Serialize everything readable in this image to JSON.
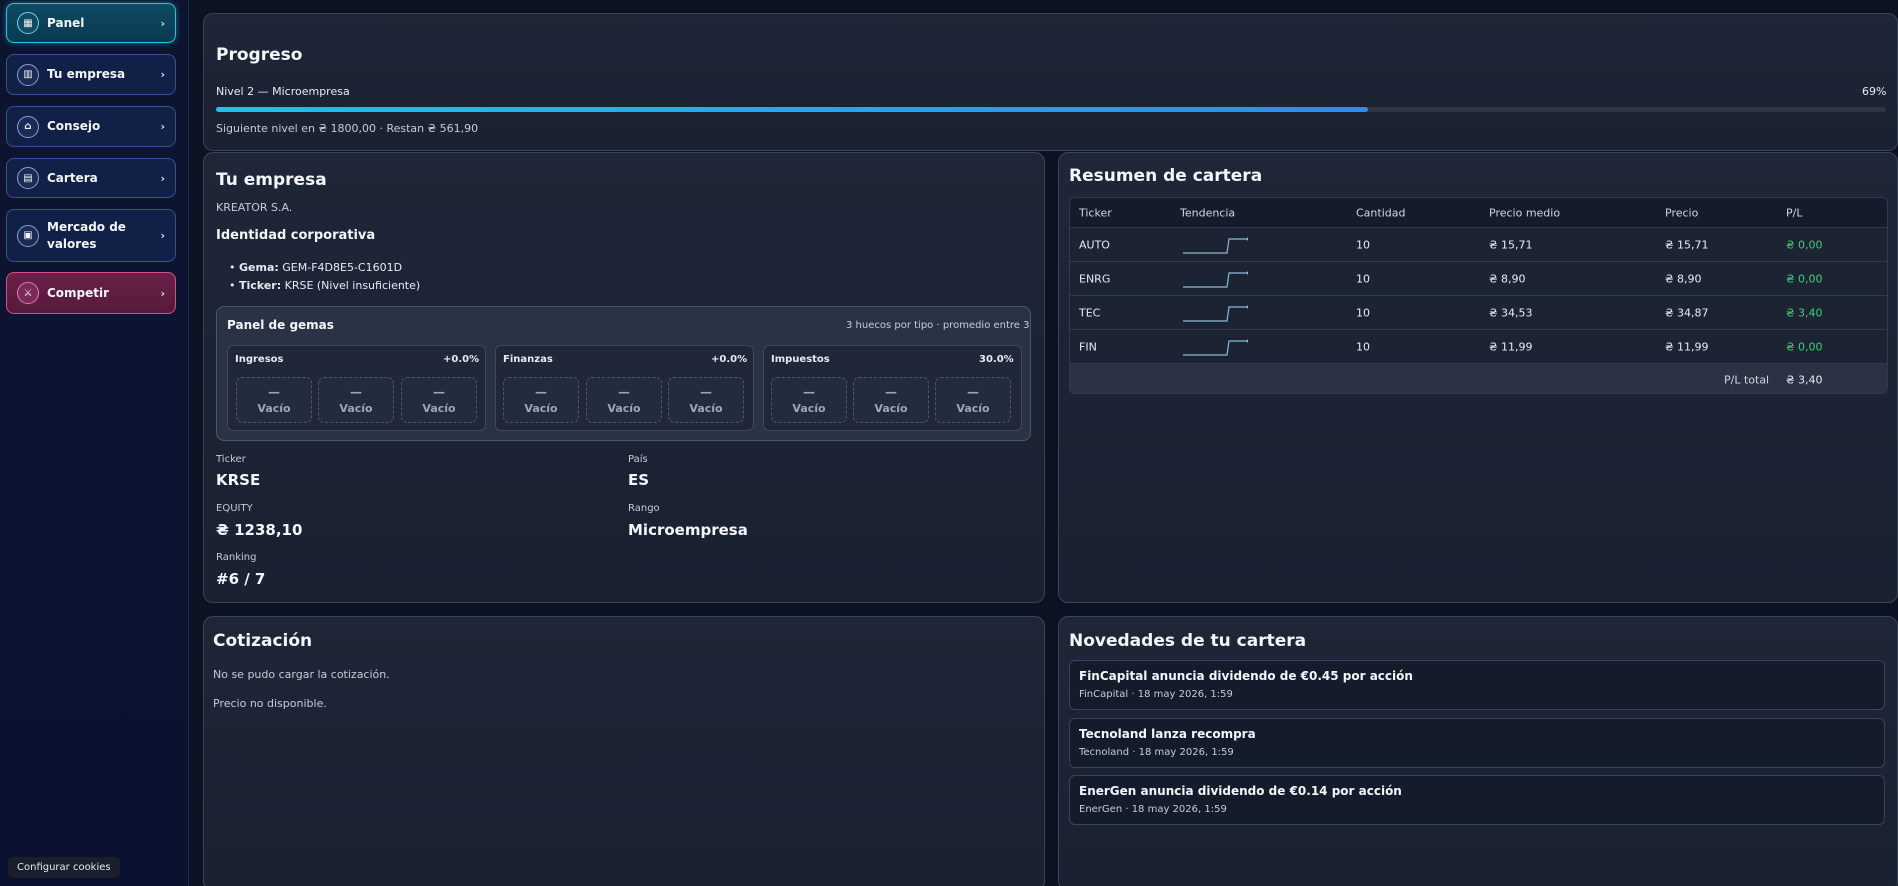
{
  "sidebar": {
    "items": [
      {
        "label": "Panel",
        "icon": "dashboard-icon"
      },
      {
        "label": "Tu empresa",
        "icon": "building-icon"
      },
      {
        "label": "Consejo",
        "icon": "bank-icon"
      },
      {
        "label": "Cartera",
        "icon": "chart-icon"
      },
      {
        "label": "Mercado de valores",
        "icon": "market-icon"
      },
      {
        "label": "Competir",
        "icon": "sword-icon"
      }
    ],
    "chevron": "›",
    "cookie_label": "Configurar cookies"
  },
  "progress": {
    "title": "Progreso",
    "level_text": "Nivel 2 — Microempresa",
    "percent_text": "69%",
    "percent_value": 0.69,
    "next_text": "Siguiente nivel en ₴ 1800,00 · Restan ₴ 561,90"
  },
  "company": {
    "title": "Tu empresa",
    "name": "KREATOR S.A.",
    "identity_title": "Identidad corporativa",
    "gem_label": "Gema:",
    "gem_value": "GEM-F4D8E5-C1601D",
    "ticker_label": "Ticker:",
    "ticker_value": "KRSE (Nivel insuficiente)",
    "gem_panel": {
      "title": "Panel de gemas",
      "note": "3 huecos por tipo · promedio entre 3",
      "groups": [
        {
          "name": "Ingresos",
          "value": "+0.0%"
        },
        {
          "name": "Finanzas",
          "value": "+0.0%"
        },
        {
          "name": "Impuestos",
          "value": "30.0%"
        }
      ],
      "slot_dash": "—",
      "slot_label": "Vacío"
    },
    "stats": {
      "ticker_label": "Ticker",
      "ticker_value": "KRSE",
      "country_label": "País",
      "country_value": "ES",
      "equity_label": "EQUITY",
      "equity_value": "₴ 1238,10",
      "rank_label": "Rango",
      "rank_value": "Microempresa",
      "ranking_label": "Ranking",
      "ranking_value": "#6 / 7"
    }
  },
  "portfolio": {
    "title": "Resumen de cartera",
    "columns": [
      "Ticker",
      "Tendencia",
      "Cantidad",
      "Precio medio",
      "Precio",
      "P/L"
    ],
    "rows": [
      {
        "ticker": "AUTO",
        "qty": "10",
        "avg": "₴ 15,71",
        "price": "₴ 15,71",
        "pl": "₴ 0,00"
      },
      {
        "ticker": "ENRG",
        "qty": "10",
        "avg": "₴ 8,90",
        "price": "₴ 8,90",
        "pl": "₴ 0,00"
      },
      {
        "ticker": "TEC",
        "qty": "10",
        "avg": "₴ 34,53",
        "price": "₴ 34,87",
        "pl": "₴ 3,40"
      },
      {
        "ticker": "FIN",
        "qty": "10",
        "avg": "₴ 11,99",
        "price": "₴ 11,99",
        "pl": "₴ 0,00"
      }
    ],
    "total_label": "P/L total",
    "total_value": "₴ 3,40",
    "positive_color": "#39d07a"
  },
  "quote": {
    "title": "Cotización",
    "error": "No se pudo cargar la cotización.",
    "unavailable": "Precio no disponible."
  },
  "news": {
    "title": "Novedades de tu cartera",
    "items": [
      {
        "title": "FinCapital anuncia dividendo de €0.45 por acción",
        "meta": "FinCapital · 18 may 2026, 1:59"
      },
      {
        "title": "Tecnoland lanza recompra",
        "meta": "Tecnoland · 18 may 2026, 1:59"
      },
      {
        "title": "EnerGen anuncia dividendo de €0.14 por acción",
        "meta": "EnerGen · 18 may 2026, 1:59"
      }
    ]
  }
}
